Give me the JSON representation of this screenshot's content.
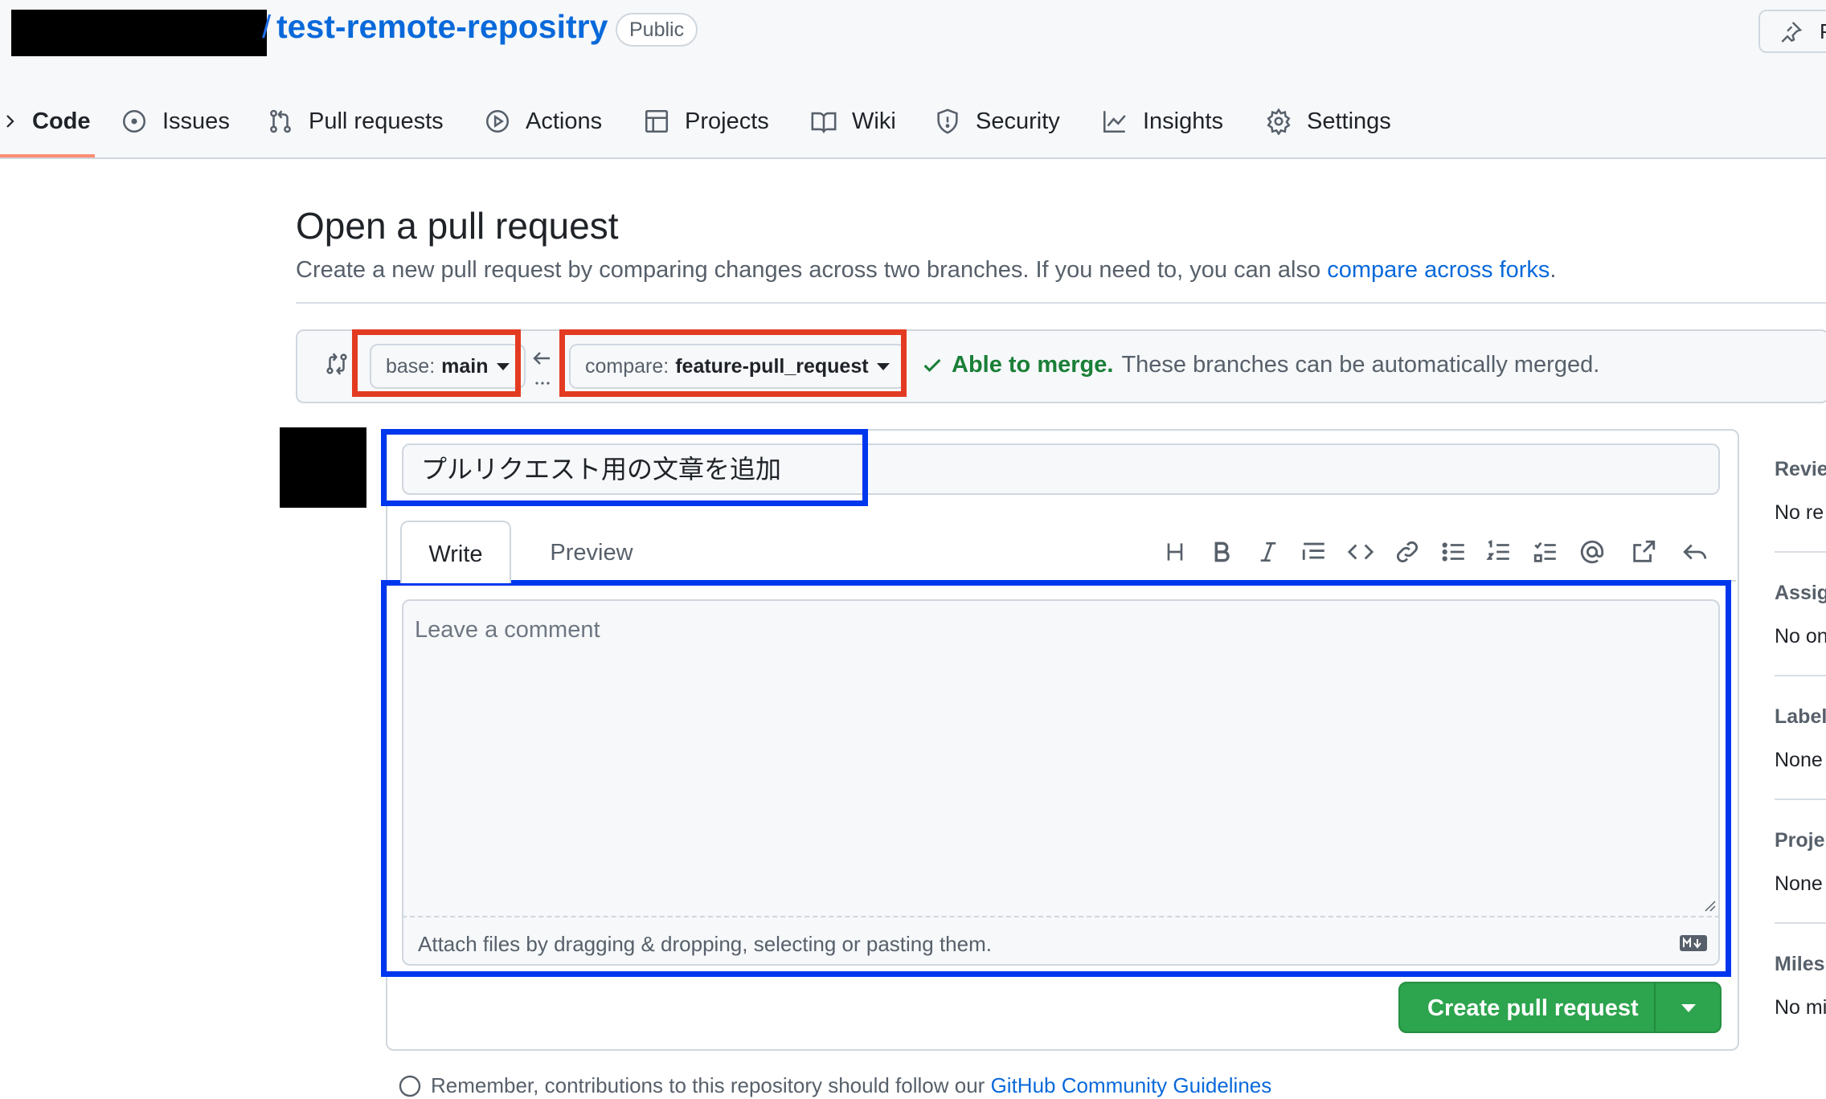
{
  "repo": {
    "name": "test-remote-repositry",
    "visibility": "Public",
    "pin_label": "P"
  },
  "nav": [
    {
      "label": "Code",
      "icon": "code-icon"
    },
    {
      "label": "Issues",
      "icon": "issue-icon"
    },
    {
      "label": "Pull requests",
      "icon": "pull-request-icon"
    },
    {
      "label": "Actions",
      "icon": "play-icon"
    },
    {
      "label": "Projects",
      "icon": "table-icon"
    },
    {
      "label": "Wiki",
      "icon": "book-icon"
    },
    {
      "label": "Security",
      "icon": "shield-icon"
    },
    {
      "label": "Insights",
      "icon": "graph-icon"
    },
    {
      "label": "Settings",
      "icon": "gear-icon"
    }
  ],
  "page": {
    "title": "Open a pull request",
    "description": "Create a new pull request by comparing changes across two branches. If you need to, you can also ",
    "description_link": "compare across forks",
    "description_end": "."
  },
  "compare": {
    "base_prefix": "base:",
    "base_branch": "main",
    "compare_prefix": "compare:",
    "compare_branch": "feature-pull_request",
    "merge_ok": "Able to merge.",
    "merge_detail": "These branches can be automatically merged."
  },
  "form": {
    "title_value": "プルリクエスト用の文章を追加",
    "tab_write": "Write",
    "tab_preview": "Preview",
    "comment_placeholder": "Leave a comment",
    "attach_text": "Attach files by dragging & dropping, selecting or pasting them.",
    "submit_label": "Create pull request"
  },
  "sidebar": [
    {
      "heading": "Revie",
      "value": "No re"
    },
    {
      "heading": "Assig",
      "value": "No on"
    },
    {
      "heading": "Label",
      "value": "None"
    },
    {
      "heading": "Proje",
      "value": "None"
    },
    {
      "heading": "Miles",
      "value": "No mi"
    }
  ],
  "footer": {
    "guideline_text": "Remember, contributions to this repository should follow our ",
    "guideline_link": "GitHub Community Guidelines"
  },
  "colors": {
    "link": "#0969da",
    "success": "#1a7f37",
    "primary_button": "#2da44e",
    "annotation_red": "#e33b22",
    "annotation_blue": "#0037ee",
    "nav_underline": "#fd8c73"
  }
}
